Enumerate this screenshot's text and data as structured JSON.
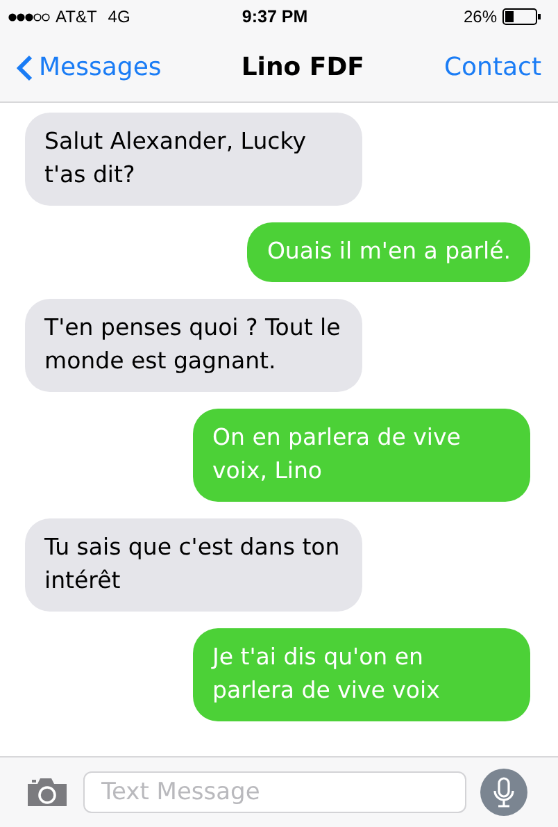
{
  "status_bar": {
    "carrier": "AT&T",
    "network": "4G",
    "time": "9:37 PM",
    "battery": "26%"
  },
  "nav": {
    "back": "Messages",
    "title": "Lino FDF",
    "action": "Contact"
  },
  "messages": [
    {
      "kind": "received",
      "text": "Salut Alexander, Lucky t'as dit?"
    },
    {
      "kind": "sent",
      "text": "Ouais il m'en a parlé."
    },
    {
      "kind": "received",
      "text": "T'en penses quoi ? Tout le monde est gagnant."
    },
    {
      "kind": "sent",
      "text": "On en parlera de vive voix, Lino"
    },
    {
      "kind": "received",
      "text": "Tu sais que c'est dans ton intérêt"
    },
    {
      "kind": "sent",
      "text": "Je t'ai dis qu'on en parlera de vive voix"
    }
  ],
  "composer": {
    "placeholder": "Text Message"
  }
}
